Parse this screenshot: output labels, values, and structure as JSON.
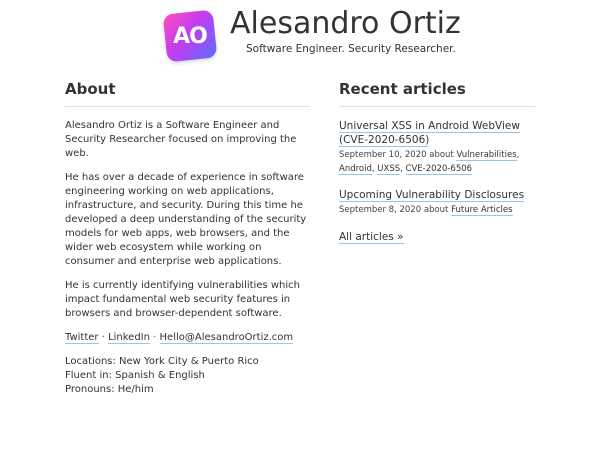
{
  "header": {
    "logo_text": "AO",
    "title": "Alesandro Ortiz",
    "subtitle": "Software Engineer. Security Researcher."
  },
  "about": {
    "heading": "About",
    "p1": "Alesandro Ortiz is a Software Engineer and Security Researcher focused on improving the web.",
    "p2": "He has over a decade of experience in software engineering working on web applications, infrastructure, and security. During this time he developed a deep understanding of the security models for web apps, web browsers, and the wider web ecosystem while working on consumer and enterprise web applications.",
    "p3": "He is currently identifying vulnerabilities which impact fundamental web security features in browsers and browser-dependent software.",
    "links": {
      "twitter": "Twitter",
      "linkedin": "LinkedIn",
      "email": "Hello@AlesandroOrtiz.com",
      "separator": " · "
    },
    "locations": "Locations: New York City & Puerto Rico",
    "fluent": "Fluent in: Spanish & English",
    "pronouns": "Pronouns: He/him"
  },
  "recent": {
    "heading": "Recent articles",
    "articles": [
      {
        "title": "Universal XSS in Android WebView (CVE-2020-6506)",
        "date_prefix": "September 10, 2020 about ",
        "tags": [
          "Vulnerabilities",
          "Android",
          "UXSS",
          "CVE-2020-6506"
        ]
      },
      {
        "title": "Upcoming Vulnerability Disclosures",
        "date_prefix": "September 8, 2020 about ",
        "tags": [
          "Future Articles"
        ]
      }
    ],
    "tag_separator": ", ",
    "all_articles": "All articles »"
  }
}
